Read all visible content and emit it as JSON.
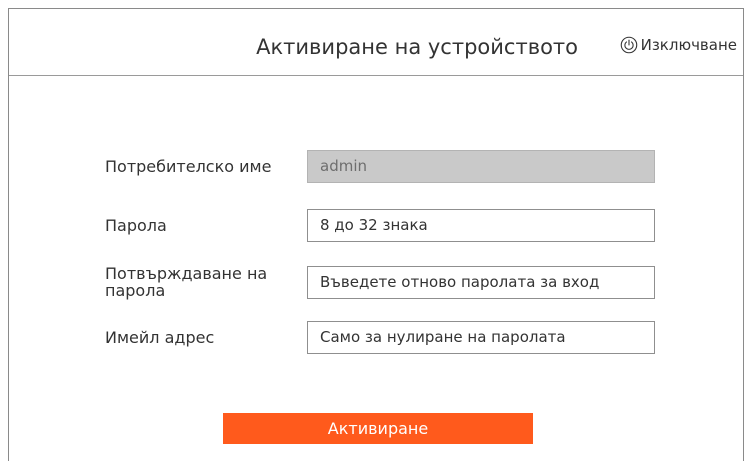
{
  "dialog": {
    "title": "Активиране на устройството",
    "shutdown_label": "Изключване"
  },
  "form": {
    "username": {
      "label": "Потребителско име",
      "value": "admin"
    },
    "password": {
      "label": "Парола",
      "placeholder": "8 до 32 знака"
    },
    "confirm_password": {
      "label_line1": "Потвърждаване на",
      "label_line2": "парола",
      "placeholder": "Въведете отново паролата за вход"
    },
    "email": {
      "label": "Имейл адрес",
      "placeholder": "Само за нулиране на паролата"
    }
  },
  "actions": {
    "activate_label": "Активиране"
  },
  "colors": {
    "accent": "#ff5a1c",
    "disabled_field": "#c9c9c9"
  },
  "icons": {
    "shutdown": "power-icon"
  }
}
